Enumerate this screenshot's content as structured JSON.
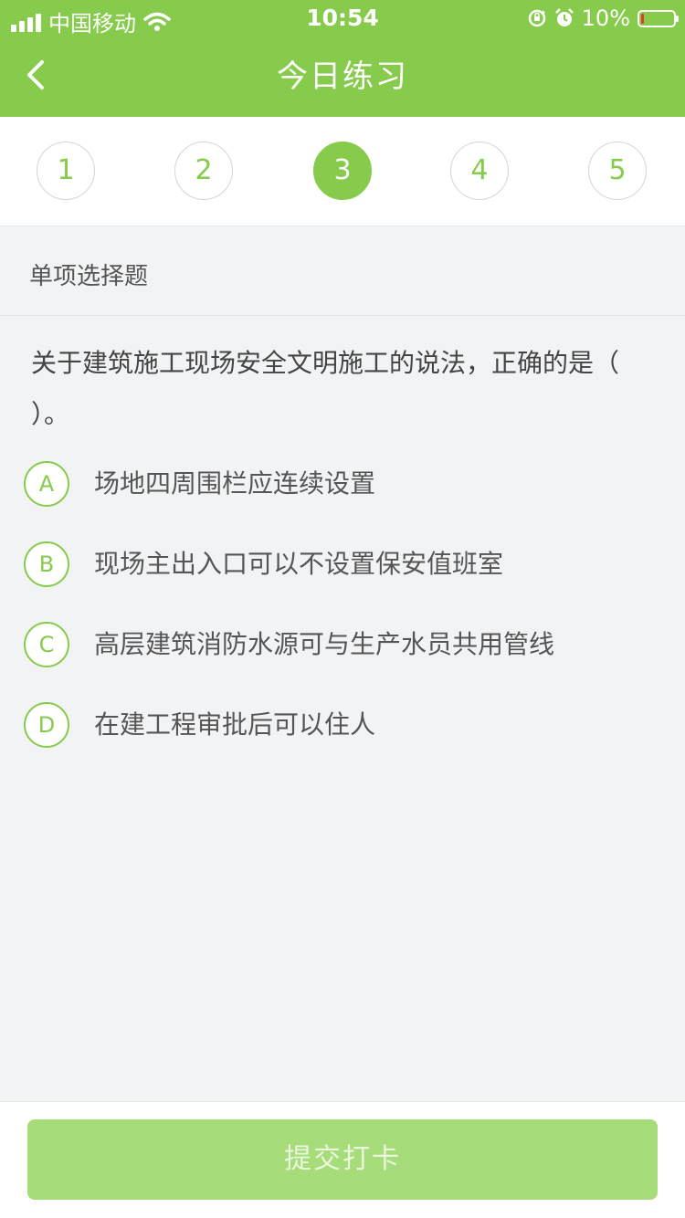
{
  "status_bar": {
    "carrier": "中国移动",
    "time": "10:54",
    "battery_percent": "10%",
    "battery_level": 0.1,
    "icons": [
      "signal-icon",
      "wifi-icon",
      "orientation-lock-icon",
      "alarm-icon",
      "battery-icon"
    ]
  },
  "nav": {
    "title": "今日练习",
    "back_icon": "chevron-left-icon"
  },
  "tabs": {
    "items": [
      "1",
      "2",
      "3",
      "4",
      "5"
    ],
    "active": "3"
  },
  "question": {
    "type_label": "单项选择题",
    "stem": "关于建筑施工现场安全文明施工的说法，正确的是（ ）。",
    "options": [
      {
        "letter": "A",
        "text": "场地四周围栏应连续设置"
      },
      {
        "letter": "B",
        "text": "现场主出入口可以不设置保安值班室"
      },
      {
        "letter": "C",
        "text": "高层建筑消防水源可与生产水员共用管线"
      },
      {
        "letter": "D",
        "text": "在建工程审批后可以住人"
      }
    ]
  },
  "footer": {
    "submit_label": "提交打卡"
  },
  "colors": {
    "accent": "#86cb4b",
    "submit_bg": "#a6dc79",
    "background": "#f2f3f5",
    "battery_low": "#e53935"
  }
}
